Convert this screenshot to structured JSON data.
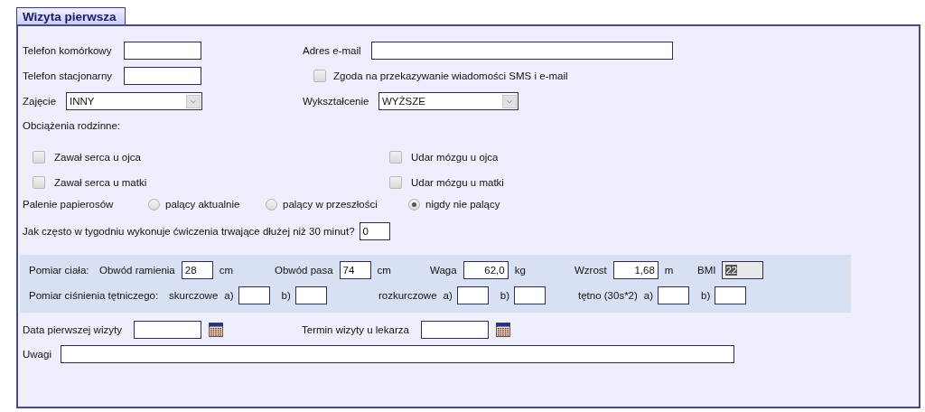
{
  "tab": {
    "label": "Wizyta pierwsza",
    "selected": true
  },
  "mobile_phone": {
    "label": "Telefon komórkowy"
  },
  "email": {
    "label": "Adres e-mail"
  },
  "landline_phone": {
    "label": "Telefon stacjonarny"
  },
  "consent": {
    "label": "Zgoda na przekazywanie wiadomości SMS i e-mail",
    "checked": false
  },
  "occupation": {
    "label": "Zajęcie",
    "value": "INNY"
  },
  "education": {
    "label": "Wykształcenie",
    "value": "WYŻSZE"
  },
  "family_history": {
    "label": "Obciążenia rodzinne:",
    "items": [
      {
        "label": "Zawał serca u ojca",
        "checked": false
      },
      {
        "label": "Udar mózgu u ojca",
        "checked": false
      },
      {
        "label": "Zawał serca u matki",
        "checked": false
      },
      {
        "label": "Udar mózgu u matki",
        "checked": false
      }
    ]
  },
  "smoking": {
    "label": "Palenie papierosów",
    "options": [
      {
        "label": "palący aktualnie",
        "selected": false
      },
      {
        "label": "palący w przeszłości",
        "selected": false
      },
      {
        "label": "nigdy nie palący",
        "selected": true
      }
    ]
  },
  "exercise": {
    "label": "Jak często w tygodniu wykonuje ćwiczenia trwające dłużej niż 30 minut?",
    "value": "0"
  },
  "body": {
    "label": "Pomiar ciała:",
    "fields": [
      {
        "label": "Obwód ramienia",
        "value": "28",
        "unit": "cm",
        "kind": "text"
      },
      {
        "label": "Obwód pasa",
        "value": "74",
        "unit": "cm",
        "kind": "text"
      },
      {
        "label": "Waga",
        "value": "62,0",
        "unit": "kg",
        "kind": "number"
      },
      {
        "label": "Wzrost",
        "value": "1,68",
        "unit": "m",
        "kind": "number"
      },
      {
        "label": "BMI",
        "value": "22",
        "kind": "computed"
      }
    ]
  },
  "blood_pressure": {
    "label": "Pomiar ciśnienia tętniczego:",
    "groups": [
      {
        "label": "skurczowe",
        "fields": [
          {
            "label": "a)"
          },
          {
            "label": "b)"
          }
        ]
      },
      {
        "label": "rozkurczowe",
        "fields": [
          {
            "label": "a)"
          },
          {
            "label": "b)"
          }
        ]
      },
      {
        "label": "tętno (30s*2)",
        "fields": [
          {
            "label": "a)"
          },
          {
            "label": "b)"
          }
        ]
      }
    ]
  },
  "first_visit_date": {
    "label": "Data pierwszej wizyty"
  },
  "doctor_appointment": {
    "label": "Termin wizyty u lekarza"
  },
  "notes": {
    "label": "Uwagi"
  }
}
